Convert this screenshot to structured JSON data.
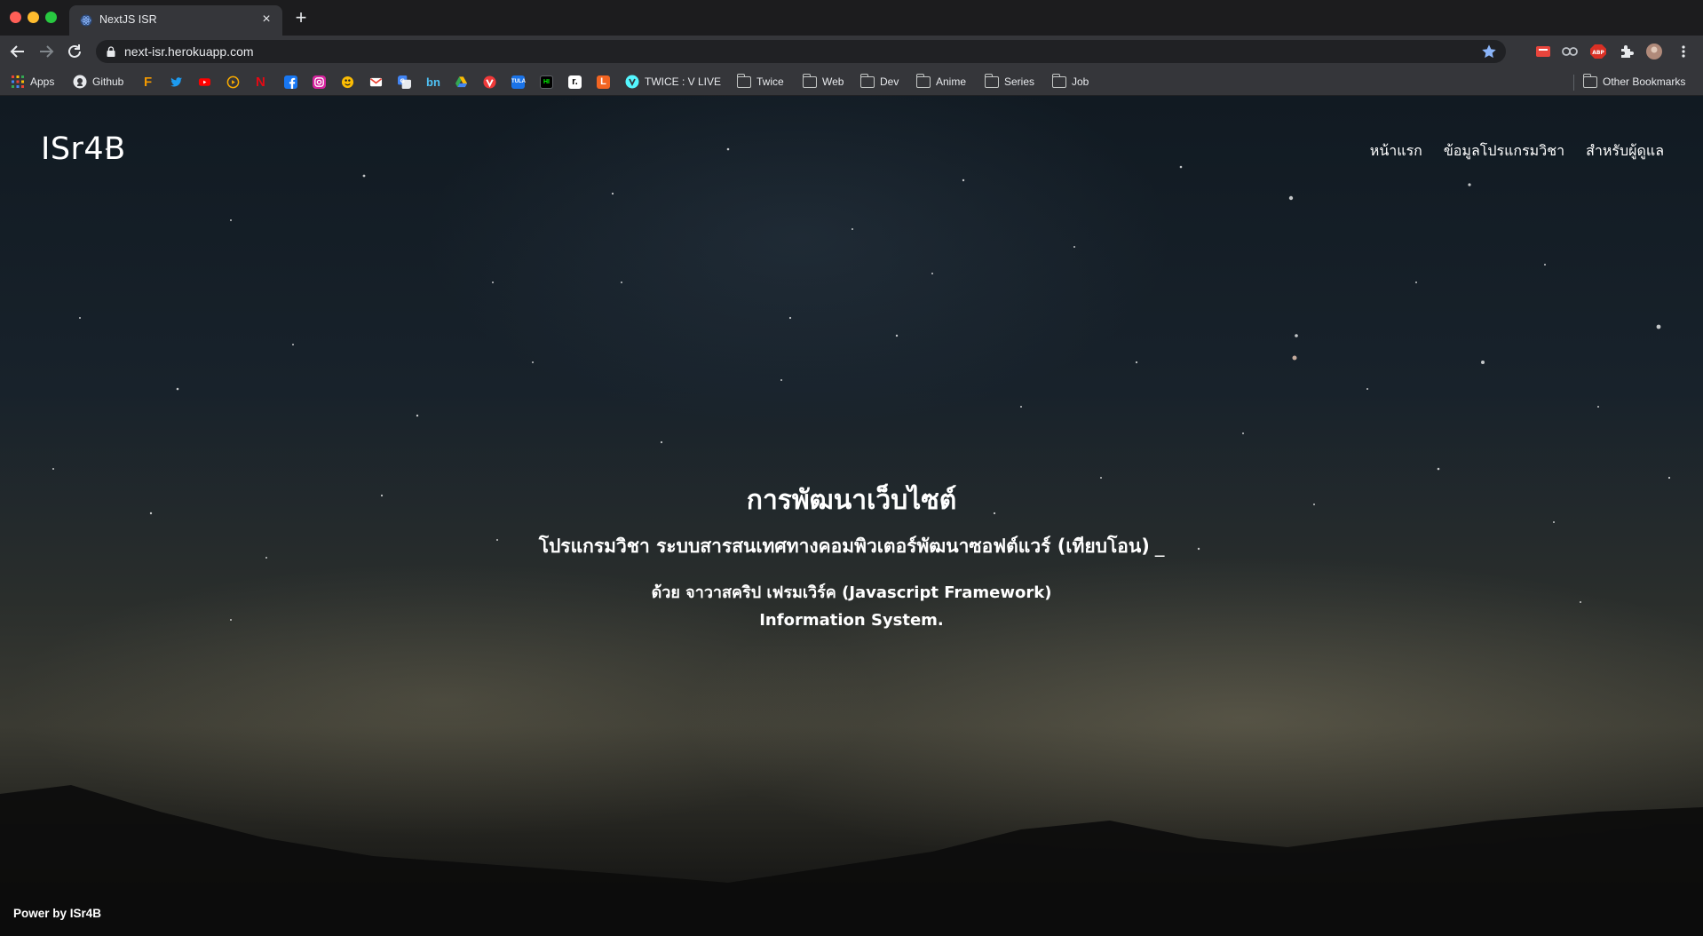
{
  "browser": {
    "tab": {
      "title": "NextJS ISR",
      "close": "×"
    },
    "new_tab": "+",
    "url": "next-isr.herokuapp.com",
    "bookmarks": [
      {
        "label": "Apps",
        "icon": "apps-grid-icon"
      },
      {
        "label": "Github",
        "icon": "github-icon"
      },
      {
        "label": "",
        "icon": "f-logo-icon"
      },
      {
        "label": "",
        "icon": "twitter-icon"
      },
      {
        "label": "",
        "icon": "youtube-icon"
      },
      {
        "label": "",
        "icon": "play-circle-icon"
      },
      {
        "label": "",
        "icon": "netflix-icon"
      },
      {
        "label": "",
        "icon": "facebook-icon"
      },
      {
        "label": "",
        "icon": "instagram-icon"
      },
      {
        "label": "",
        "icon": "pacman-icon"
      },
      {
        "label": "",
        "icon": "gmail-icon"
      },
      {
        "label": "",
        "icon": "google-translate-icon"
      },
      {
        "label": "",
        "icon": "bn-icon"
      },
      {
        "label": "",
        "icon": "google-drive-icon"
      },
      {
        "label": "",
        "icon": "vivaldi-icon"
      },
      {
        "label": "",
        "icon": "tula-icon"
      },
      {
        "label": "",
        "icon": "hackernoon-icon"
      },
      {
        "label": "",
        "icon": "r-icon"
      },
      {
        "label": "",
        "icon": "l-icon"
      },
      {
        "label": "TWICE : V LIVE",
        "icon": "vlive-icon"
      },
      {
        "label": "Twice",
        "icon": "folder-icon"
      },
      {
        "label": "Web",
        "icon": "folder-icon"
      },
      {
        "label": "Dev",
        "icon": "folder-icon"
      },
      {
        "label": "Anime",
        "icon": "folder-icon"
      },
      {
        "label": "Series",
        "icon": "folder-icon"
      },
      {
        "label": "Job",
        "icon": "folder-icon"
      }
    ],
    "other_bookmarks": "Other Bookmarks"
  },
  "site": {
    "brand": "ISr4B",
    "menu": [
      "หน้าแรก",
      "ข้อมูลโปรแกรมวิชา",
      "สำหรับผู้ดูแล"
    ],
    "hero": {
      "title": "การพัฒนาเว็บไซต์",
      "subtitle": "โปรแกรมวิชา ระบบสารสนเทศทางคอมพิวเตอร์พัฒนาซอฟต์แวร์ (เทียบโอน)",
      "caret": "_",
      "line3": "ด้วย จาวาสคริป เฟรมเวิร์ค (Javascript Framework)",
      "line4": "Information System."
    },
    "footer": "Power by ISr4B"
  },
  "colors": {
    "tabstrip": "#1c1c1e",
    "toolbar": "#35363a",
    "omnibox": "#202124",
    "star_accent": "#8ab4f8"
  }
}
